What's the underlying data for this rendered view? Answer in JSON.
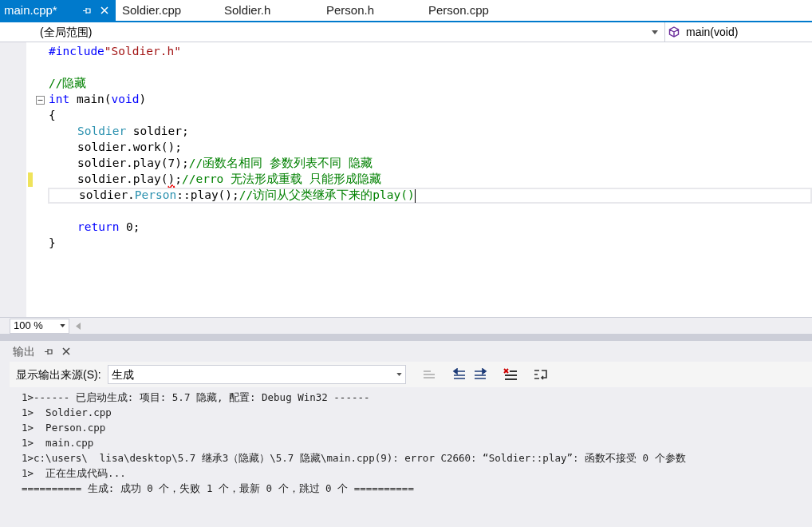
{
  "tabs": [
    {
      "label": "main.cpp*",
      "selected": true
    },
    {
      "label": "Soldier.cpp",
      "selected": false
    },
    {
      "label": "Soldier.h",
      "selected": false
    },
    {
      "label": "Person.h",
      "selected": false
    },
    {
      "label": "Person.cpp",
      "selected": false
    }
  ],
  "nav_bar": {
    "scope": "(全局范围)",
    "member": "main(void)"
  },
  "code_lines": [
    {
      "changed": false,
      "current": false,
      "fold": false,
      "tokens": [
        {
          "kind": "keyword",
          "text": "#include"
        },
        {
          "kind": "string",
          "text": "\"Soldier.h\""
        }
      ]
    },
    {
      "changed": false,
      "current": false,
      "fold": false
    },
    {
      "changed": false,
      "current": false,
      "fold": false,
      "tokens": [
        {
          "kind": "comment",
          "text": "//隐藏"
        }
      ]
    },
    {
      "changed": false,
      "current": false,
      "fold": true,
      "tokens": [
        {
          "kind": "keyword",
          "text": "int"
        },
        {
          "kind": "plain",
          "text": " main("
        },
        {
          "kind": "keyword",
          "text": "void"
        },
        {
          "kind": "plain",
          "text": ")"
        }
      ]
    },
    {
      "changed": false,
      "current": false,
      "fold": false,
      "tokens": [
        {
          "kind": "plain",
          "text": "{"
        }
      ],
      "children": [
        {
          "changed": false,
          "current": false,
          "fold": false,
          "tokens": [
            {
              "kind": "type",
              "text": "Soldier"
            },
            {
              "kind": "plain",
              "text": " soldier;"
            }
          ]
        },
        {
          "changed": false,
          "current": false,
          "fold": false,
          "tokens": [
            {
              "kind": "plain",
              "text": "soldier.work();"
            }
          ]
        },
        {
          "changed": false,
          "current": false,
          "fold": false,
          "tokens": [
            {
              "kind": "plain",
              "text": "soldier.play(7);"
            },
            {
              "kind": "comment",
              "text": "//函数名相同 参数列表不同 隐藏"
            }
          ]
        },
        {
          "changed": true,
          "current": false,
          "fold": false,
          "tokens": [
            {
              "kind": "plain",
              "text": "soldier.play("
            },
            {
              "kind": "error",
              "text": ")"
            },
            {
              "kind": "plain",
              "text": ";"
            },
            {
              "kind": "comment",
              "text": "//erro 无法形成重载 只能形成隐藏"
            }
          ]
        },
        {
          "changed": false,
          "current": true,
          "fold": false,
          "tokens": [
            {
              "kind": "plain",
              "text": "soldier."
            },
            {
              "kind": "type",
              "text": "Person"
            },
            {
              "kind": "plain",
              "text": "::play();"
            },
            {
              "kind": "comment",
              "text": "//访问从父类继承下来的play()"
            }
          ]
        },
        {
          "changed": false,
          "current": false,
          "fold": false
        },
        {
          "changed": false,
          "current": false,
          "fold": false,
          "tokens": [
            {
              "kind": "keyword",
              "text": "return"
            },
            {
              "kind": "plain",
              "text": " 0;"
            }
          ]
        }
      ]
    },
    {
      "changed": false,
      "current": false,
      "fold": false,
      "tokens": [
        {
          "kind": "plain",
          "text": "}"
        }
      ]
    }
  ],
  "zoom": "100 %",
  "output_panel": {
    "title": "输出",
    "source_label": "显示输出来源(S):",
    "source_value": "生成",
    "lines": [
      "1>------ 已启动生成: 项目: 5.7 隐藏, 配置: Debug Win32 ------",
      "1>  Soldier.cpp",
      "1>  Person.cpp",
      "1>  main.cpp",
      "1>c:\\users\\  lisa\\desktop\\5.7 继承3（隐藏）\\5.7 隐藏\\main.cpp(9): error C2660: “Soldier::play”: 函数不接受 0 个参数",
      "1>  正在生成代码...",
      "========== 生成: 成功 0 个，失败 1 个，最新 0 个，跳过 0 个 =========="
    ]
  }
}
